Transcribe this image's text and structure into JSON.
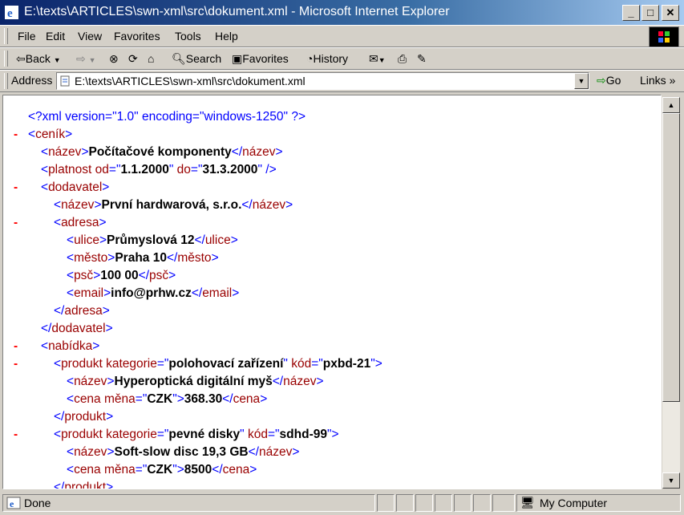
{
  "window": {
    "title": "E:\\texts\\ARTICLES\\swn-xml\\src\\dokument.xml - Microsoft Internet Explorer"
  },
  "menu": [
    "File",
    "Edit",
    "View",
    "Favorites",
    "Tools",
    "Help"
  ],
  "toolbar": {
    "back": "Back",
    "search": "Search",
    "favorites": "Favorites",
    "history": "History"
  },
  "address": {
    "label": "Address",
    "value": "E:\\texts\\ARTICLES\\swn-xml\\src\\dokument.xml",
    "go": "Go",
    "links": "Links"
  },
  "xml": {
    "decl_open": "<?xml ",
    "decl_attr1": "version",
    "decl_val1": "\"1.0\"",
    "decl_attr2": " encoding",
    "decl_val2": "\"windows-1250\"",
    "decl_close": " ?>",
    "lines": [
      {
        "minus": "",
        "indent": 0,
        "html": "decl"
      },
      {
        "minus": "-",
        "indent": 0,
        "open": "ceník"
      },
      {
        "minus": "",
        "indent": 1,
        "tag": "název",
        "text": "Počítačové komponenty"
      },
      {
        "minus": "",
        "indent": 1,
        "empty": "platnost",
        "attrs": [
          [
            "od",
            "1.1.2000"
          ],
          [
            "do",
            "31.3.2000"
          ]
        ]
      },
      {
        "minus": "-",
        "indent": 1,
        "open": "dodavatel"
      },
      {
        "minus": "",
        "indent": 2,
        "tag": "název",
        "text": "První hardwarová, s.r.o."
      },
      {
        "minus": "-",
        "indent": 2,
        "open": "adresa"
      },
      {
        "minus": "",
        "indent": 3,
        "tag": "ulice",
        "text": "Průmyslová 12"
      },
      {
        "minus": "",
        "indent": 3,
        "tag": "město",
        "text": "Praha 10"
      },
      {
        "minus": "",
        "indent": 3,
        "tag": "psč",
        "text": "100 00"
      },
      {
        "minus": "",
        "indent": 3,
        "tag": "email",
        "text": "info@prhw.cz"
      },
      {
        "minus": "",
        "indent": 2,
        "close": "adresa"
      },
      {
        "minus": "",
        "indent": 1,
        "close": "dodavatel"
      },
      {
        "minus": "-",
        "indent": 1,
        "open": "nabídka"
      },
      {
        "minus": "-",
        "indent": 2,
        "open": "produkt",
        "attrs": [
          [
            "kategorie",
            "polohovací zařízení"
          ],
          [
            "kód",
            "pxbd-21"
          ]
        ]
      },
      {
        "minus": "",
        "indent": 3,
        "tag": "název",
        "text": "Hyperoptická digitální myš"
      },
      {
        "minus": "",
        "indent": 3,
        "tag": "cena",
        "attrs": [
          [
            "měna",
            "CZK"
          ]
        ],
        "text": "368.30"
      },
      {
        "minus": "",
        "indent": 2,
        "close": "produkt"
      },
      {
        "minus": "-",
        "indent": 2,
        "open": "produkt",
        "attrs": [
          [
            "kategorie",
            "pevné disky"
          ],
          [
            "kód",
            "sdhd-99"
          ]
        ]
      },
      {
        "minus": "",
        "indent": 3,
        "tag": "název",
        "text": "Soft-slow disc 19,3 GB"
      },
      {
        "minus": "",
        "indent": 3,
        "tag": "cena",
        "attrs": [
          [
            "měna",
            "CZK"
          ]
        ],
        "text": "8500"
      },
      {
        "minus": "",
        "indent": 2,
        "close": "produkt"
      }
    ]
  },
  "status": {
    "text": "Done",
    "zone": "My Computer"
  }
}
